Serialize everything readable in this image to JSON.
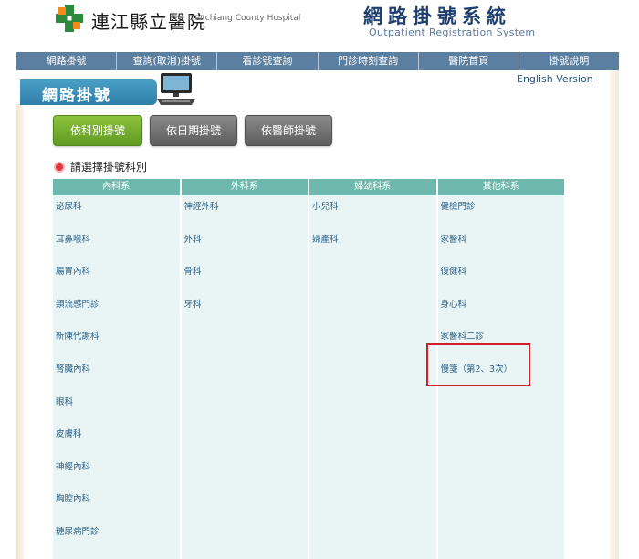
{
  "header": {
    "hospital_name": "連江縣立醫院",
    "hospital_name_en": "Lienchiang County Hospital",
    "system_title": "網路掛號系統",
    "system_title_en": "Outpatient Registration System"
  },
  "nav": {
    "items": [
      "網路掛號",
      "查詢(取消)掛號",
      "看診號查詢",
      "門診時刻查詢",
      "醫院首頁",
      "掛號說明"
    ]
  },
  "section": {
    "title": "網路掛號",
    "english_link": "English Version"
  },
  "buttons": {
    "by_department": "依科別掛號",
    "by_date": "依日期掛號",
    "by_doctor": "依醫師掛號"
  },
  "prompt": "請選擇掛號科別",
  "departments": {
    "headers": [
      "內科系",
      "外科系",
      "婦幼科系",
      "其他科系"
    ],
    "internal": [
      "泌尿科",
      "耳鼻喉科",
      "腸胃內科",
      "類流感門診",
      "新陳代謝科",
      "腎臟內科",
      "眼科",
      "皮膚科",
      "神經內科",
      "胸腔內科",
      "糖尿病門診"
    ],
    "surgical": [
      "神經外科",
      "外科",
      "骨科",
      "牙科"
    ],
    "women_children": [
      "小兒科",
      "婦產科"
    ],
    "other": [
      "健檢門診",
      "家醫科",
      "復健科",
      "身心科",
      "家醫科二診",
      "慢箋（第2、3次）"
    ]
  },
  "colors": {
    "nav_bg": "#5b7fa0",
    "table_header": "#6fb8ad",
    "table_bg": "#e9f5f5",
    "link": "#2a5f85",
    "highlight": "#d32027"
  }
}
